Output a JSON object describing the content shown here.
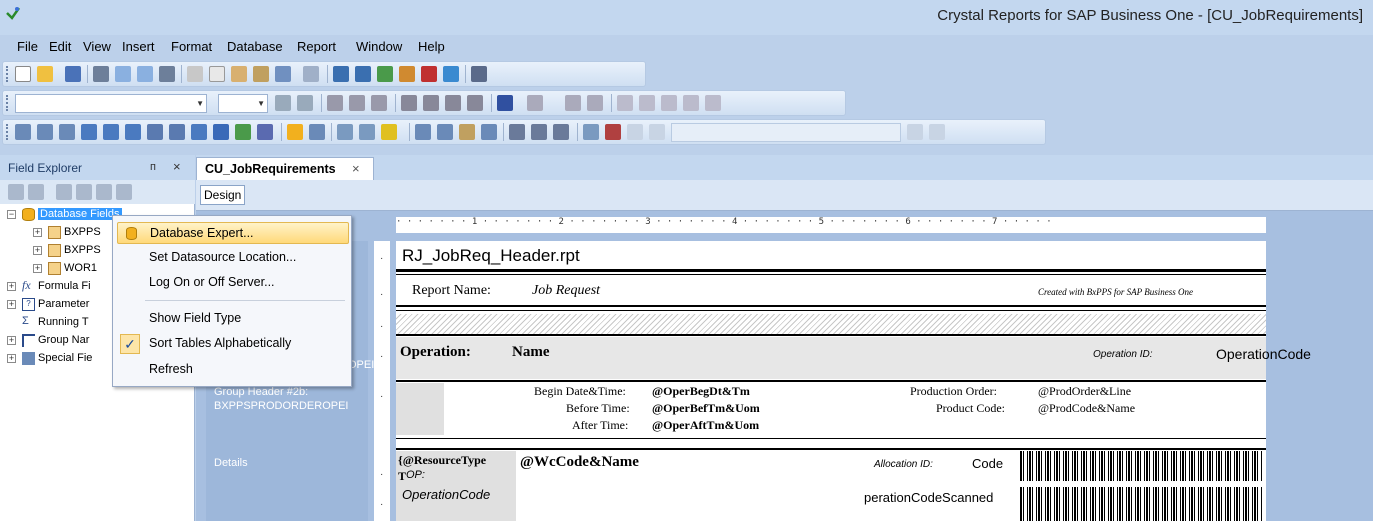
{
  "window": {
    "title": "Crystal Reports for SAP Business One - [CU_JobRequirements]"
  },
  "menu": [
    "File",
    "Edit",
    "View",
    "Insert",
    "Format",
    "Database",
    "Report",
    "Window",
    "Help"
  ],
  "field_explorer": {
    "title": "Field Explorer",
    "pin": "ᴨ",
    "close": "×",
    "tree": [
      {
        "label": "Database Fields",
        "expander": "⊟",
        "icon": "database-icon",
        "selected": true
      },
      {
        "label": "BXPPS",
        "expander": "⊞",
        "icon": "table-icon"
      },
      {
        "label": "BXPPS",
        "expander": "⊞",
        "icon": "table-icon"
      },
      {
        "label": "WOR1",
        "expander": "⊞",
        "icon": "table-icon"
      },
      {
        "label": "Formula Fi",
        "expander": "⊞",
        "icon": "formula-icon"
      },
      {
        "label": "Parameter",
        "expander": "⊞",
        "icon": "parameter-icon"
      },
      {
        "label": "Running T",
        "expander": "",
        "icon": "running-total-icon"
      },
      {
        "label": "Group Nar",
        "expander": "⊞",
        "icon": "group-icon"
      },
      {
        "label": "Special Fie",
        "expander": "⊞",
        "icon": "special-field-icon"
      }
    ]
  },
  "context_menu": {
    "items": [
      {
        "label": "Database Expert...",
        "highlighted": true
      },
      {
        "label": "Set Datasource Location..."
      },
      {
        "label": "Log On or Off Server..."
      },
      {
        "label": "Show Field Type"
      },
      {
        "label": "Sort Tables Alphabetically",
        "checked": true
      },
      {
        "label": "Refresh"
      }
    ],
    "check_mark": "✓"
  },
  "document": {
    "tab_label": "CU_JobRequirements",
    "tab_close": "×",
    "design_tab": "Design",
    "ruler": "· · · · · · · 1 · · · · · · · 2 · · · · · · · 3 · · · · · · · 4 · · · · · · · 5 · · · · · · · 6 · · · · · · · 7 · · · · ·",
    "section_labels": {
      "group_header_2a_tail": "OPEI",
      "group_header_2b": "Group Header #2b:",
      "group_header_2b_field": "BXPPSPRODORDEROPEI",
      "details": "Details"
    },
    "fields": {
      "report_file": "RJ_JobReq_Header.rpt",
      "report_name_label": "Report Name:",
      "report_name_value": "Job Request",
      "created_with": "Created with BxPPS for SAP Business One",
      "operation_label": "Operation:",
      "operation_name": "Name",
      "operation_id_label": "Operation ID:",
      "operation_code": "OperationCode",
      "begin_label": "Begin Date&Time:",
      "begin_value": "@OperBegDt&Tm",
      "before_label": "Before Time:",
      "before_value": "@OperBefTm&Uom",
      "after_label": "After Time:",
      "after_value": "@OperAftTm&Uom",
      "prod_order_label": "Production Order:",
      "prod_order_value": "@ProdOrder&Line",
      "product_code_label": "Product Code:",
      "product_code_value": "@ProdCode&Name",
      "resource_type": "{@ResourceType",
      "resource_type_2": "T",
      "op_label": "OP:",
      "wc_code": "@WcCode&Name",
      "allocation_label": "Allocation ID:",
      "allocation_code": "Code",
      "operation_code_scanned": "perationCodeScanned"
    }
  }
}
